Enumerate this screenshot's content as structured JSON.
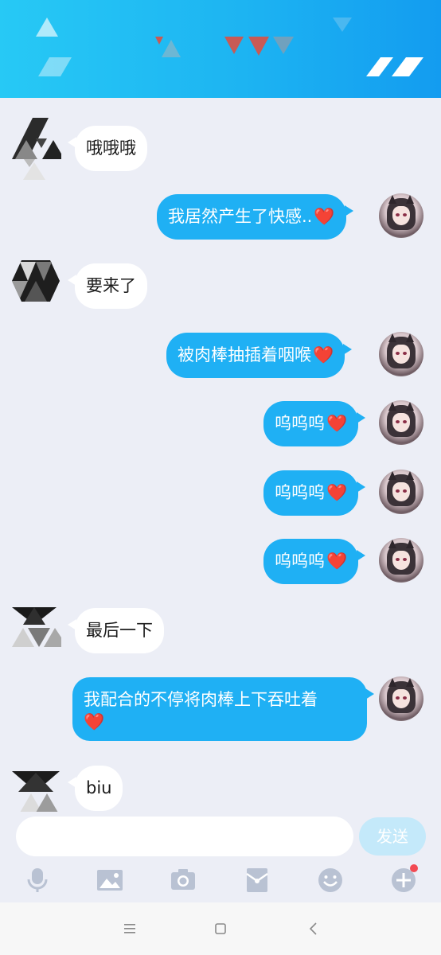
{
  "header": {
    "accent_colors": {
      "cyan": "#27c9f5",
      "blue": "#139cf0",
      "red_triangle": "#c85a55"
    }
  },
  "messages": [
    {
      "side": "in",
      "text": "哦哦哦",
      "heart": false
    },
    {
      "side": "out",
      "text": "我居然产生了快感..",
      "heart": true
    },
    {
      "side": "in",
      "text": "要来了",
      "heart": false
    },
    {
      "side": "out",
      "text": "被肉棒抽插着咽喉",
      "heart": true
    },
    {
      "side": "out",
      "text": "呜呜呜",
      "heart": true
    },
    {
      "side": "out",
      "text": "呜呜呜",
      "heart": true
    },
    {
      "side": "out",
      "text": "呜呜呜",
      "heart": true
    },
    {
      "side": "in",
      "text": "最后一下",
      "heart": false
    },
    {
      "side": "out",
      "text": "我配合的不停将肉棒上下吞吐着",
      "heart": true
    },
    {
      "side": "in",
      "text": "biu",
      "heart": false
    }
  ],
  "heart_glyph": "❤️",
  "composer": {
    "input_value": "",
    "input_placeholder": "",
    "send_label": "发送"
  },
  "toolbar": {
    "icons": [
      "microphone-icon",
      "image-icon",
      "camera-icon",
      "red-packet-icon",
      "emoji-icon",
      "plus-icon"
    ],
    "plus_has_notification_dot": true
  },
  "system_nav": {
    "icons": [
      "menu-icon",
      "home-icon",
      "back-icon"
    ]
  },
  "colors": {
    "outgoing_bubble": "#1fb0f4",
    "incoming_bubble": "#ffffff",
    "background": "#eceef6",
    "send_button": "#c4e9fa"
  }
}
